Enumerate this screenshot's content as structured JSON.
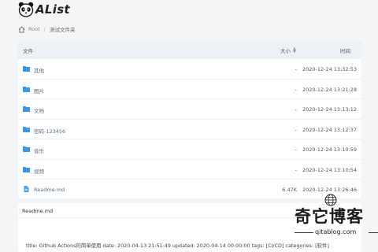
{
  "app": {
    "title": "AList"
  },
  "breadcrumb": {
    "root": "Root",
    "separator": "/",
    "current": "测试文件夹"
  },
  "table": {
    "columns": {
      "name": "文件",
      "size": "大小",
      "time": "时间"
    },
    "rows": [
      {
        "name": "其他",
        "size": "-",
        "time": "2020-12-24 13:32:53",
        "type": "folder"
      },
      {
        "name": "图片",
        "size": "-",
        "time": "2020-12-24 13:21:28",
        "type": "folder"
      },
      {
        "name": "文档",
        "size": "-",
        "time": "2020-12-24 13:13:12",
        "type": "folder"
      },
      {
        "name": "密码-123456",
        "size": "-",
        "time": "2020-12-24 13:12:37",
        "type": "folder"
      },
      {
        "name": "音乐",
        "size": "-",
        "time": "2020-12-24 13:10:59",
        "type": "folder"
      },
      {
        "name": "视频",
        "size": "-",
        "time": "2020-12-24 13:10:54",
        "type": "folder"
      },
      {
        "name": "Readme.md",
        "size": "6.47K",
        "time": "2020-12-24 13:26:46",
        "type": "file"
      }
    ]
  },
  "readme": {
    "title": "Readme.md",
    "body": "title: Github Actions的简单使用 date: 2020-04-13 21:51:49 updated: 2020-04-14 00:00:00 tags: [CI/CD] categories: [软件]"
  },
  "watermark": {
    "title": "奇它博客",
    "domain": "qitablog.com"
  },
  "colors": {
    "folder": "#3d95e6",
    "file": "#4a9fe8",
    "link": "#5a6e88",
    "header_bg": "#edf1f6"
  }
}
